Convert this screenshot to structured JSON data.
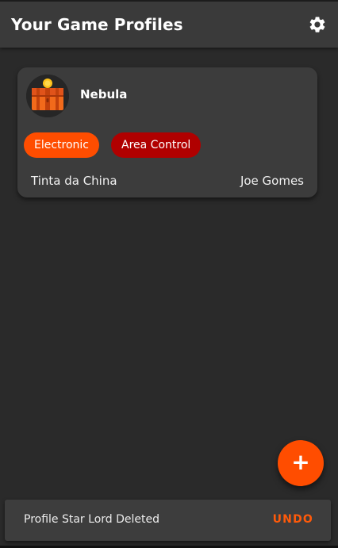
{
  "appbar": {
    "title": "Your Game Profiles",
    "settings_icon": "gear-icon"
  },
  "profiles": [
    {
      "name": "Nebula",
      "avatar_icon": "treasure-chest-icon",
      "tags": [
        "Electronic",
        "Area Control"
      ],
      "publisher": "Tinta da China",
      "designer": "Joe Gomes"
    }
  ],
  "fab": {
    "label": "+",
    "icon": "plus-icon"
  },
  "snackbar": {
    "message": "Profile Star Lord Deleted",
    "action": "UNDO"
  },
  "colors": {
    "background": "#2a2a2a",
    "appbar": "#3a3a3a",
    "card": "#3c3c3c",
    "accent": "#ff4d00",
    "tag_electronic": "#ff4d00",
    "tag_area_control": "#b00000",
    "snackbar": "#3d3d3d",
    "snackbar_action": "#ff5a0a"
  }
}
